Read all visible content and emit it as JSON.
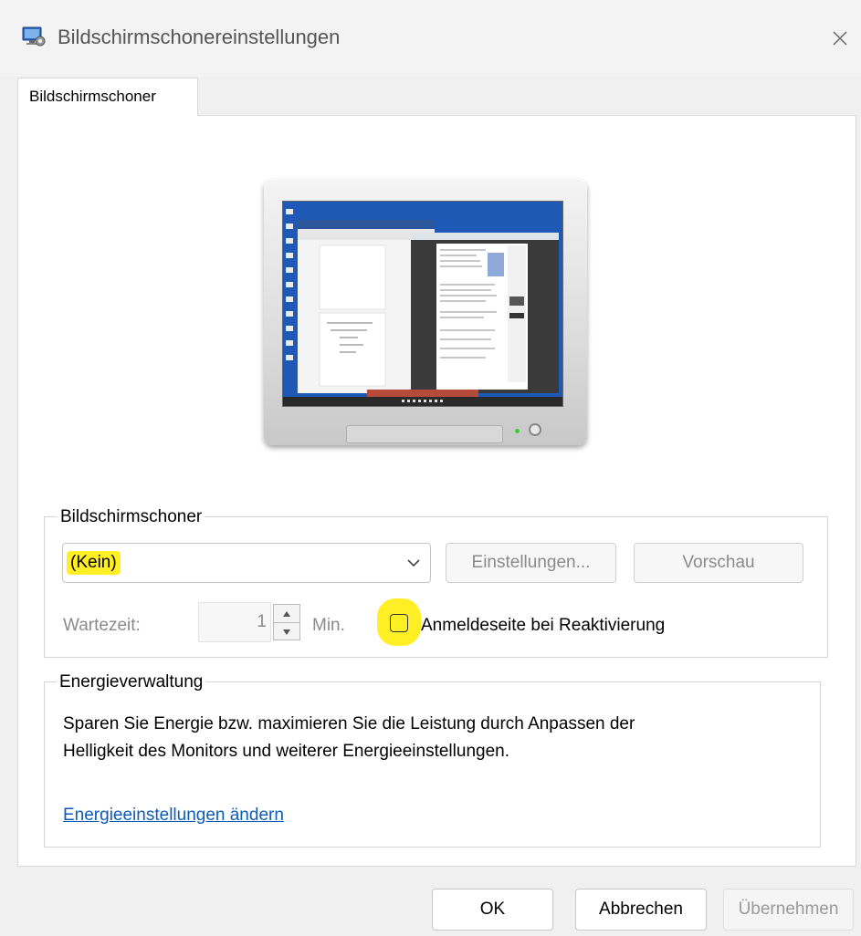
{
  "window": {
    "title": "Bildschirmschonereinstellungen",
    "icon": "monitor-settings-icon",
    "close_icon": "close-icon"
  },
  "tabs": [
    {
      "label": "Bildschirmschoner",
      "active": true
    }
  ],
  "screensaver_group": {
    "title": "Bildschirmschoner",
    "dropdown_value": "(Kein)",
    "settings_button": "Einstellungen...",
    "preview_button": "Vorschau",
    "wait_label": "Wartezeit:",
    "wait_value": "1",
    "wait_unit": "Min.",
    "logon_checkbox_label": "Anmeldeseite bei Reaktivierung",
    "logon_checkbox_checked": false
  },
  "power_group": {
    "title": "Energieverwaltung",
    "description_line1": "Sparen Sie Energie bzw. maximieren Sie die Leistung durch Anpassen der",
    "description_line2": "Helligkeit des Monitors und weiterer Energieeinstellungen.",
    "link": "Energieeinstellungen ändern"
  },
  "buttons": {
    "ok": "OK",
    "cancel": "Abbrechen",
    "apply": "Übernehmen"
  },
  "colors": {
    "highlight": "#ffef24",
    "link": "#0b5cb8",
    "disabled_text": "#8a8a8a"
  }
}
